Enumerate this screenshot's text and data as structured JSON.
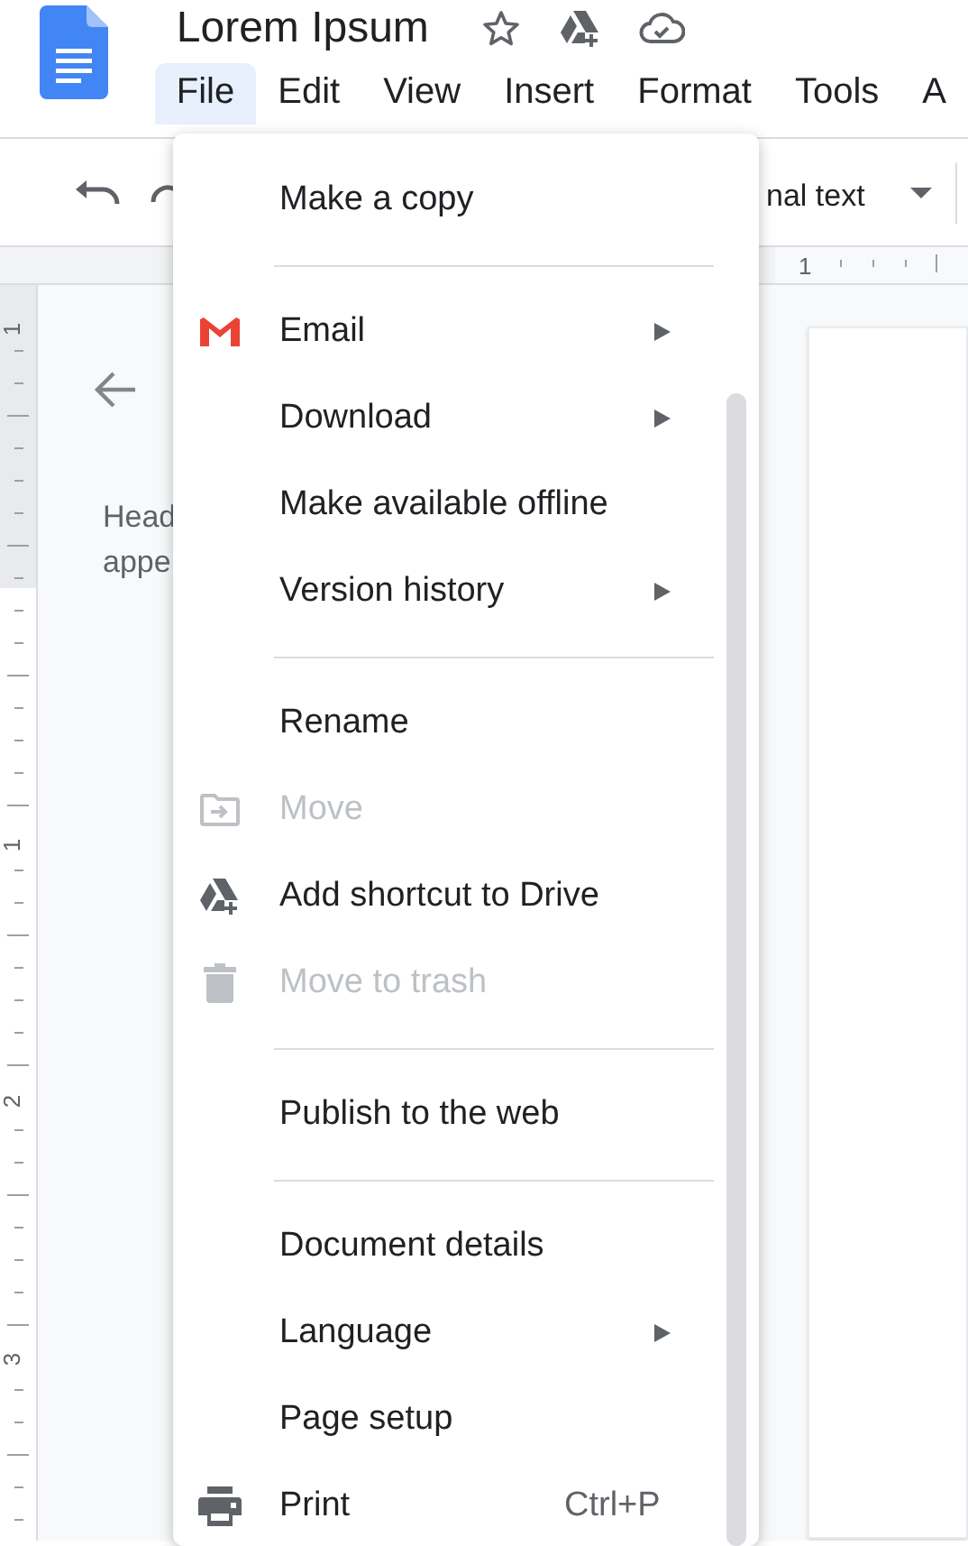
{
  "document": {
    "title": "Lorem Ipsum"
  },
  "menubar": [
    {
      "label": "File",
      "selected": true
    },
    {
      "label": "Edit",
      "selected": false
    },
    {
      "label": "View",
      "selected": false
    },
    {
      "label": "Insert",
      "selected": false
    },
    {
      "label": "Format",
      "selected": false
    },
    {
      "label": "Tools",
      "selected": false
    },
    {
      "label": "A",
      "selected": false
    }
  ],
  "toolbar": {
    "style_dropdown": "nal text"
  },
  "horizontal_ruler": [
    "1"
  ],
  "vertical_ruler": [
    "1",
    "1",
    "2",
    "3"
  ],
  "outline": {
    "lines": [
      "Head",
      "appe"
    ]
  },
  "file_menu": [
    {
      "kind": "item",
      "label": "Make a copy",
      "disabled": false,
      "submenu": false
    },
    {
      "kind": "divider"
    },
    {
      "kind": "item",
      "label": "Email",
      "disabled": false,
      "submenu": true
    },
    {
      "kind": "item",
      "label": "Download",
      "disabled": false,
      "submenu": true
    },
    {
      "kind": "item",
      "label": "Make available offline",
      "disabled": false,
      "submenu": false
    },
    {
      "kind": "item",
      "label": "Version history",
      "disabled": false,
      "submenu": true
    },
    {
      "kind": "divider"
    },
    {
      "kind": "item",
      "label": "Rename",
      "disabled": false,
      "submenu": false
    },
    {
      "kind": "item",
      "label": "Move",
      "disabled": true,
      "submenu": false
    },
    {
      "kind": "item",
      "label": "Add shortcut to Drive",
      "disabled": false,
      "submenu": false
    },
    {
      "kind": "item",
      "label": "Move to trash",
      "disabled": true,
      "submenu": false
    },
    {
      "kind": "divider"
    },
    {
      "kind": "item",
      "label": "Publish to the web",
      "disabled": false,
      "submenu": false
    },
    {
      "kind": "divider"
    },
    {
      "kind": "item",
      "label": "Document details",
      "disabled": false,
      "submenu": false
    },
    {
      "kind": "item",
      "label": "Language",
      "disabled": false,
      "submenu": true
    },
    {
      "kind": "item",
      "label": "Page setup",
      "disabled": false,
      "submenu": false
    },
    {
      "kind": "item",
      "label": "Print",
      "disabled": false,
      "submenu": false,
      "shortcut": "Ctrl+P"
    }
  ]
}
